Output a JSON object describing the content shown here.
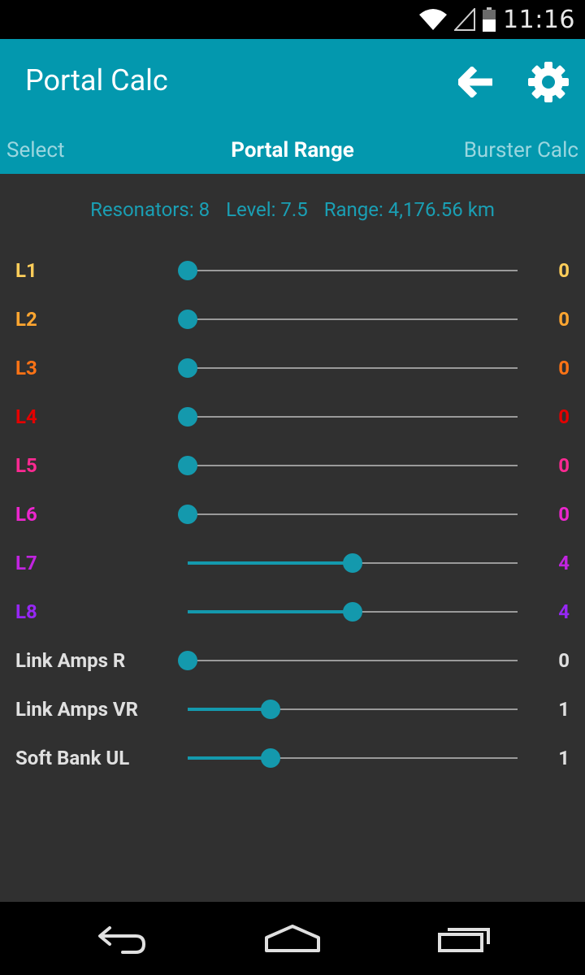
{
  "status_bar": {
    "time": "11:16",
    "icons": [
      "wifi-icon",
      "cell-signal-icon",
      "battery-icon"
    ]
  },
  "action_bar": {
    "title": "Portal Calc",
    "back_icon": "arrow-left-icon",
    "settings_icon": "gear-icon",
    "background": "#0398ae"
  },
  "tabs": [
    {
      "label": "Select",
      "active": false
    },
    {
      "label": "Portal Range",
      "active": true
    },
    {
      "label": "Burster Calc",
      "active": false
    }
  ],
  "summary": {
    "resonators": "Resonators: 8",
    "level": "Level: 7.5",
    "range": "Range: 4,176.56 km"
  },
  "accent_color": "#1499ad",
  "rows": [
    {
      "label": "L1",
      "value": "0",
      "max": 8,
      "color": "#fece5a"
    },
    {
      "label": "L2",
      "value": "0",
      "max": 8,
      "color": "#ffa630"
    },
    {
      "label": "L3",
      "value": "0",
      "max": 8,
      "color": "#ff7315"
    },
    {
      "label": "L4",
      "value": "0",
      "max": 8,
      "color": "#e40000"
    },
    {
      "label": "L5",
      "value": "0",
      "max": 8,
      "color": "#fd2992"
    },
    {
      "label": "L6",
      "value": "0",
      "max": 8,
      "color": "#eb26cd"
    },
    {
      "label": "L7",
      "value": "4",
      "max": 8,
      "color": "#c124e0"
    },
    {
      "label": "L8",
      "value": "4",
      "max": 8,
      "color": "#9627f4"
    },
    {
      "label": "Link Amps R",
      "value": "0",
      "max": 4,
      "color": "#e0e0e0"
    },
    {
      "label": "Link Amps VR",
      "value": "1",
      "max": 4,
      "color": "#e0e0e0"
    },
    {
      "label": "Soft Bank UL",
      "value": "1",
      "max": 4,
      "color": "#e0e0e0"
    }
  ],
  "nav_bar": {
    "back_icon": "nav-back-icon",
    "home_icon": "nav-home-icon",
    "recents_icon": "nav-recents-icon"
  }
}
